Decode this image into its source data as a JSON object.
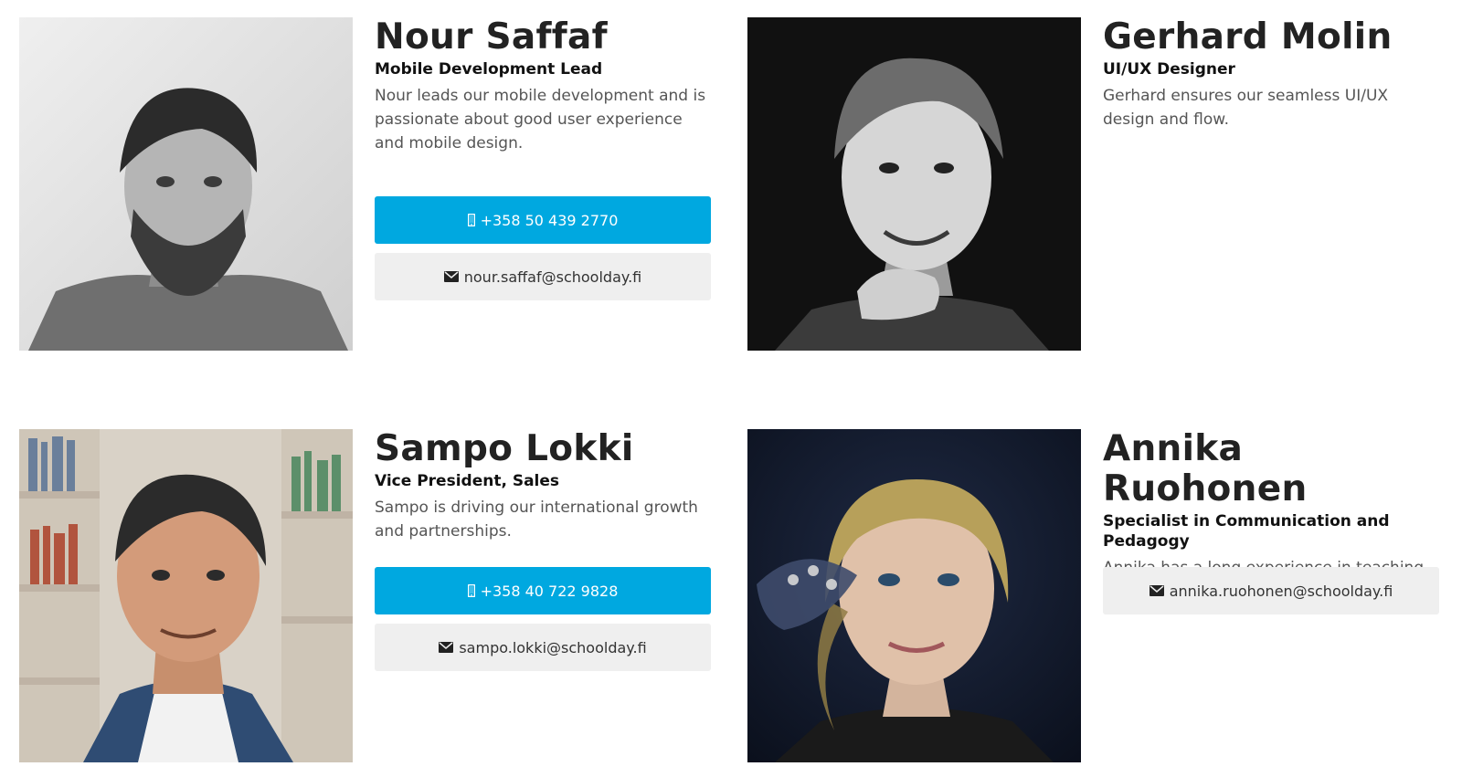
{
  "colors": {
    "phone_button_bg": "#00a8e0",
    "email_button_bg": "#efefef",
    "name_text": "#222222",
    "description_text": "#555555"
  },
  "team": [
    {
      "name": "Nour Saffaf",
      "role": "Mobile Development Lead",
      "description": "Nour leads our mobile development and is passionate about good user experience and mobile design.",
      "phone": "+358 50 439 2770",
      "email": "nour.saffaf@schoolday.fi",
      "photo_icon": "portrait-photo"
    },
    {
      "name": "Gerhard Molin",
      "role": "UI/UX Designer",
      "description": "Gerhard ensures our seamless UI/UX design and flow.",
      "photo_icon": "portrait-photo"
    },
    {
      "name": "Sampo Lokki",
      "role": "Vice President, Sales",
      "description": "Sampo is driving our international growth and partnerships.",
      "phone": "+358 40 722 9828",
      "email": "sampo.lokki@schoolday.fi",
      "photo_icon": "portrait-photo"
    },
    {
      "name": "Annika Ruohonen",
      "role": "Specialist in Communication and Pedagogy",
      "description": "Annika has a long experience in teaching and communications.",
      "email": "annika.ruohonen@schoolday.fi",
      "photo_icon": "portrait-photo"
    }
  ],
  "icons": {
    "phone": "mobile-phone-icon",
    "email": "envelope-icon"
  }
}
